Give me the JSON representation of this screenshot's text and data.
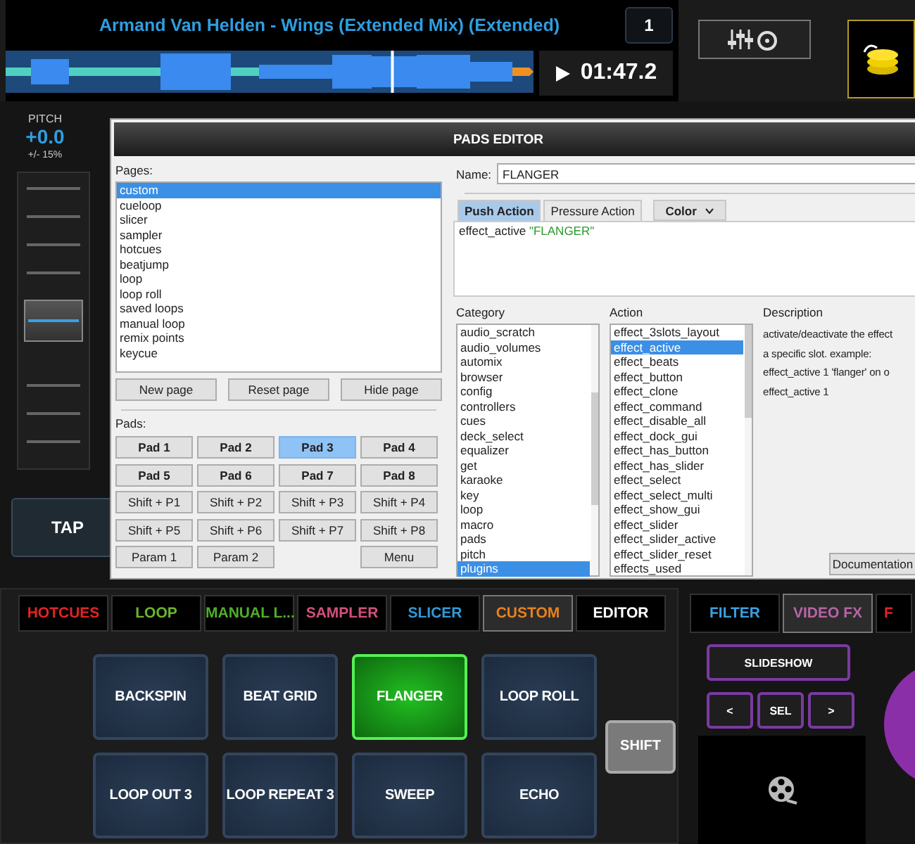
{
  "deck": {
    "title": "Armand Van Helden - Wings (Extended Mix) (Extended)",
    "number": "1",
    "time": "01:47.2",
    "position": {
      "level": 0.73
    }
  },
  "pitch": {
    "label": "PITCH",
    "value": "+0.0",
    "range": "+/- 15%",
    "level": 0.5
  },
  "tap": "TAP",
  "dialog": {
    "title": "PADS EDITOR",
    "pages_label": "Pages:",
    "pages": [
      {
        "label": "custom",
        "selected": true
      },
      {
        "label": "cueloop",
        "selected": false
      },
      {
        "label": "slicer",
        "selected": false
      },
      {
        "label": "sampler",
        "selected": false
      },
      {
        "label": "hotcues",
        "selected": false
      },
      {
        "label": "beatjump",
        "selected": false
      },
      {
        "label": "loop",
        "selected": false
      },
      {
        "label": "loop roll",
        "selected": false
      },
      {
        "label": "saved loops",
        "selected": false
      },
      {
        "label": "manual loop",
        "selected": false
      },
      {
        "label": "remix points",
        "selected": false
      },
      {
        "label": "keycue",
        "selected": false
      }
    ],
    "page_buttons": [
      "New page",
      "Reset page",
      "Hide page"
    ],
    "pads_label": "Pads:",
    "pad_buttons": [
      {
        "label": "Pad 1",
        "kind": "pad",
        "selected": false
      },
      {
        "label": "Pad 2",
        "kind": "pad",
        "selected": false
      },
      {
        "label": "Pad 3",
        "kind": "pad",
        "selected": true
      },
      {
        "label": "Pad 4",
        "kind": "pad",
        "selected": false
      },
      {
        "label": "Pad 5",
        "kind": "pad",
        "selected": false
      },
      {
        "label": "Pad 6",
        "kind": "pad",
        "selected": false
      },
      {
        "label": "Pad 7",
        "kind": "pad",
        "selected": false
      },
      {
        "label": "Pad 8",
        "kind": "pad",
        "selected": false
      },
      {
        "label": "Shift + P1",
        "kind": "shift",
        "selected": false
      },
      {
        "label": "Shift + P2",
        "kind": "shift",
        "selected": false
      },
      {
        "label": "Shift + P3",
        "kind": "shift",
        "selected": false
      },
      {
        "label": "Shift + P4",
        "kind": "shift",
        "selected": false
      },
      {
        "label": "Shift + P5",
        "kind": "shift",
        "selected": false
      },
      {
        "label": "Shift + P6",
        "kind": "shift",
        "selected": false
      },
      {
        "label": "Shift + P7",
        "kind": "shift",
        "selected": false
      },
      {
        "label": "Shift + P8",
        "kind": "shift",
        "selected": false
      }
    ],
    "param_buttons": [
      "Param 1",
      "Param 2"
    ],
    "menu_button": "Menu",
    "name_label": "Name:",
    "name_value": "FLANGER",
    "action_tabs": [
      {
        "label": "Push Action",
        "selected": true
      },
      {
        "label": "Pressure Action",
        "selected": false
      }
    ],
    "color_dropdown": "Color",
    "script": {
      "command": "effect_active",
      "argument": "\"FLANGER\""
    },
    "category_label": "Category",
    "categories": [
      {
        "label": "audio_scratch",
        "selected": false
      },
      {
        "label": "audio_volumes",
        "selected": false
      },
      {
        "label": "automix",
        "selected": false
      },
      {
        "label": "browser",
        "selected": false
      },
      {
        "label": "config",
        "selected": false
      },
      {
        "label": "controllers",
        "selected": false
      },
      {
        "label": "cues",
        "selected": false
      },
      {
        "label": "deck_select",
        "selected": false
      },
      {
        "label": "equalizer",
        "selected": false
      },
      {
        "label": "get",
        "selected": false
      },
      {
        "label": "karaoke",
        "selected": false
      },
      {
        "label": "key",
        "selected": false
      },
      {
        "label": "loop",
        "selected": false
      },
      {
        "label": "macro",
        "selected": false
      },
      {
        "label": "pads",
        "selected": false
      },
      {
        "label": "pitch",
        "selected": false
      },
      {
        "label": "plugins",
        "selected": true
      }
    ],
    "action_label": "Action",
    "actions": [
      {
        "label": "effect_3slots_layout",
        "selected": false
      },
      {
        "label": "effect_active",
        "selected": true
      },
      {
        "label": "effect_beats",
        "selected": false
      },
      {
        "label": "effect_button",
        "selected": false
      },
      {
        "label": "effect_clone",
        "selected": false
      },
      {
        "label": "effect_command",
        "selected": false
      },
      {
        "label": "effect_disable_all",
        "selected": false
      },
      {
        "label": "effect_dock_gui",
        "selected": false
      },
      {
        "label": "effect_has_button",
        "selected": false
      },
      {
        "label": "effect_has_slider",
        "selected": false
      },
      {
        "label": "effect_select",
        "selected": false
      },
      {
        "label": "effect_select_multi",
        "selected": false
      },
      {
        "label": "effect_show_gui",
        "selected": false
      },
      {
        "label": "effect_slider",
        "selected": false
      },
      {
        "label": "effect_slider_active",
        "selected": false
      },
      {
        "label": "effect_slider_reset",
        "selected": false
      },
      {
        "label": "effects_used",
        "selected": false
      }
    ],
    "description_label": "Description",
    "description": [
      "activate/deactivate the effect",
      "a specific slot. example:",
      "effect_active 1 'flanger' on o",
      "effect_active 1"
    ],
    "documentation_button": "Documentation"
  },
  "pad_tabs": [
    {
      "label": "HOTCUES",
      "color": "#e02424",
      "selected": false
    },
    {
      "label": "LOOP",
      "color": "#6bb52f",
      "selected": false
    },
    {
      "label": "MANUAL L...",
      "color": "#4fae2b",
      "selected": false
    },
    {
      "label": "SAMPLER",
      "color": "#d0507c",
      "selected": false
    },
    {
      "label": "SLICER",
      "color": "#2f9ad6",
      "selected": false
    },
    {
      "label": "CUSTOM",
      "color": "#e8821e",
      "selected": true
    },
    {
      "label": "EDITOR",
      "color": "#ffffff",
      "selected": false
    }
  ],
  "pads": [
    {
      "label": "BACKSPIN",
      "selected": false
    },
    {
      "label": "BEAT GRID",
      "selected": false
    },
    {
      "label": "FLANGER",
      "selected": true
    },
    {
      "label": "LOOP ROLL",
      "selected": false
    },
    {
      "label": "LOOP OUT 3",
      "selected": false
    },
    {
      "label": "LOOP REPEAT 3",
      "selected": false
    },
    {
      "label": "SWEEP",
      "selected": false
    },
    {
      "label": "ECHO",
      "selected": false
    }
  ],
  "shift": "SHIFT",
  "fx_tabs": [
    {
      "label": "FILTER",
      "color": "#3aa0e0",
      "selected": false
    },
    {
      "label": "VIDEO FX",
      "color": "#b565a5",
      "selected": true
    },
    {
      "label": "F",
      "color": "#e02424",
      "selected": false
    }
  ],
  "video": {
    "slideshow": "SLIDESHOW",
    "prev": "<",
    "sel": "SEL",
    "next": ">"
  }
}
